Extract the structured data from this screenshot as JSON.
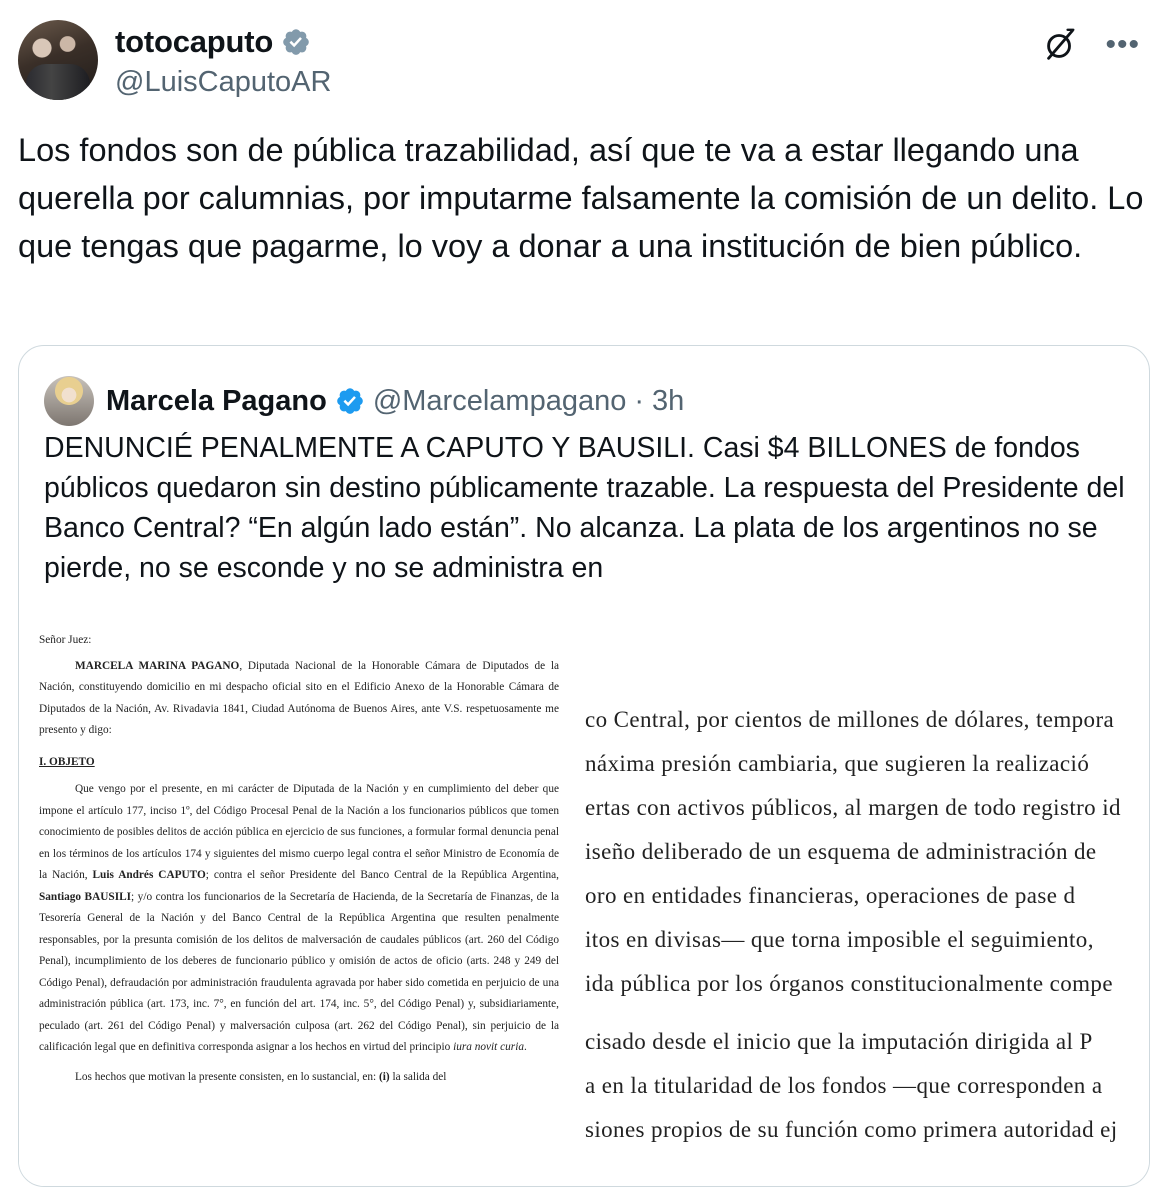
{
  "author": {
    "display_name": "totocaputo",
    "handle": "@LuisCaputoAR",
    "verified_color": "#829aab"
  },
  "tweet": {
    "text": "Los fondos son de pública trazabilidad, así que te va a estar llegando una querella por calumnias, por imputarme falsamente la comisión de un delito. Lo que tengas que pagarme, lo voy a donar a una institución de bien público."
  },
  "quote": {
    "display_name": "Marcela Pagano",
    "handle": "@Marcelampagano",
    "separator": "·",
    "time": "3h",
    "verified_color": "#1d9bf0",
    "text": "DENUNCIÉ PENALMENTE A CAPUTO Y BAUSILI. Casi $4 BILLONES de fondos públicos quedaron sin destino públicamente trazable. La respuesta del Presidente del Banco Central? “En algún lado están”. No alcanza. La plata de los argentinos no se pierde, no se esconde y no se administra en"
  },
  "document_left": {
    "greeting": "Señor Juez:",
    "p1_name": "MARCELA MARINA PAGANO",
    "p1_rest": ", Diputada Nacional de la Honorable Cámara de Diputados de la Nación, constituyendo domicilio en mi despacho oficial sito en el Edificio Anexo de la Honorable Cámara de Diputados de la Nación, Av. Rivadavia 1841, Ciudad Autónoma de Buenos Aires, ante V.S. respetuosamente me presento y digo:",
    "section": "I. OBJETO",
    "p2_a": "Que vengo por el presente, en mi carácter de Diputada de la Nación y en cumplimiento del deber que impone el artículo 177, inciso 1º, del Código Procesal Penal de la Nación a los funcionarios públicos que tomen conocimiento de posibles delitos de acción pública en ejercicio de sus funciones, a formular formal denuncia penal en los términos de los artículos 174 y siguientes del mismo cuerpo legal contra el señor Ministro de Economía de la Nación, ",
    "p2_b": "Luis Andrés CAPUTO",
    "p2_c": "; contra el señor Presidente del Banco Central de la República Argentina, ",
    "p2_d": "Santiago BAUSILI",
    "p2_e": "; y/o contra los funcionarios de la Secretaría de Hacienda, de la Secretaría de Finanzas, de la Tesorería General de la Nación y del Banco Central de la República Argentina que resulten penalmente responsables, por la presunta comisión de los delitos de malversación de caudales públicos (art. 260 del Código Penal), incumplimiento de los deberes de funcionario público y omisión de actos de oficio (arts. 248 y 249 del Código Penal), defraudación por administración fraudulenta agravada por haber sido cometida en perjuicio de una administración pública (art. 173, inc. 7°, en función del art. 174, inc. 5°, del Código Penal) y, subsidiariamente, peculado (art. 261 del Código Penal) y malversación culposa (art. 262 del Código Penal), sin perjuicio de la calificación legal que en definitiva corresponda asignar a los hechos en virtud del principio ",
    "p2_f": "iura novit curia",
    "p2_g": ".",
    "p3_a": "Los hechos que motivan la presente consisten, en lo sustancial, en: ",
    "p3_b": "(i)",
    "p3_c": " la salida del"
  },
  "document_right": {
    "lines": [
      "co Central, por cientos de millones de dólares, tempora",
      "náxima presión cambiaria, que sugieren la realizació",
      "ertas con activos públicos, al margen de todo registro id",
      "iseño deliberado de un esquema de administración de",
      "oro en entidades financieras, operaciones de pase d",
      "itos en divisas— que torna imposible el seguimiento,",
      "ida pública por los órganos constitucionalmente compe",
      "cisado desde el inicio que la imputación dirigida al P",
      "a en la titularidad de los fondos —que corresponden a",
      "siones propios de su función como primera autoridad ej"
    ]
  },
  "icons": {
    "grok": "grok-icon",
    "more": "more-icon"
  }
}
